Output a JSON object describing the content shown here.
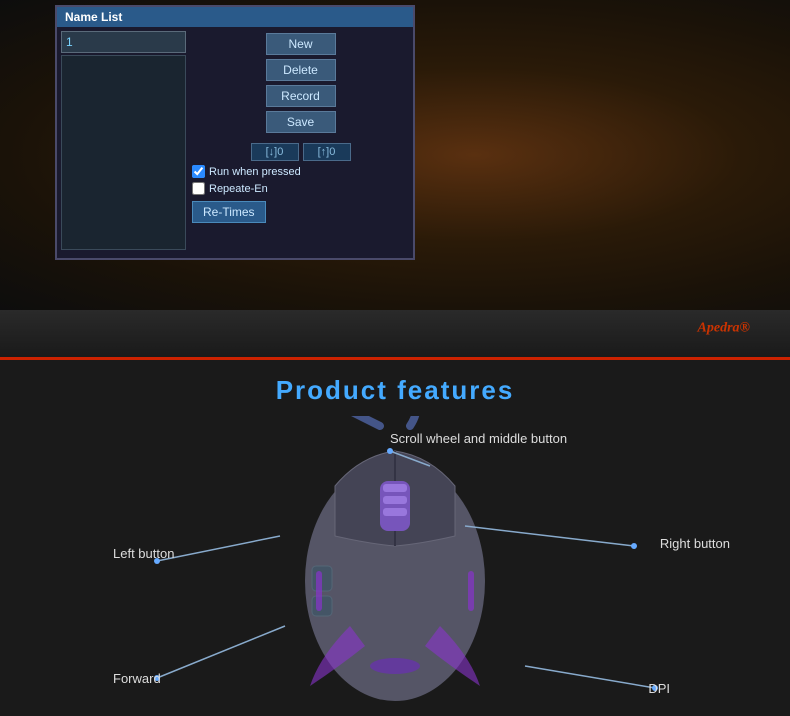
{
  "panel": {
    "header": "Name List",
    "input_value": "1",
    "buttons": {
      "new": "New",
      "delete": "Delete",
      "record": "Record",
      "save": "Save"
    },
    "arrows": {
      "down": "[↓]0",
      "up": "[↑]0"
    },
    "checkboxes": {
      "run_when_pressed": {
        "label": "Run when pressed",
        "checked": true
      },
      "repeate_en": {
        "label": "Repeate-En",
        "checked": false
      }
    },
    "re_times": "Re-Times"
  },
  "brand": {
    "name": "Apedra",
    "suffix": "®"
  },
  "features": {
    "title": "Product features",
    "labels": {
      "scroll": "Scroll wheel and middle button",
      "left": "Left button",
      "right": "Right button",
      "forward": "Forward",
      "dpi": "DPI"
    }
  },
  "colors": {
    "accent_blue": "#44aaff",
    "brand_red": "#cc3300",
    "panel_header": "#2a5a8a",
    "btn_bg": "#3a5a7a"
  }
}
